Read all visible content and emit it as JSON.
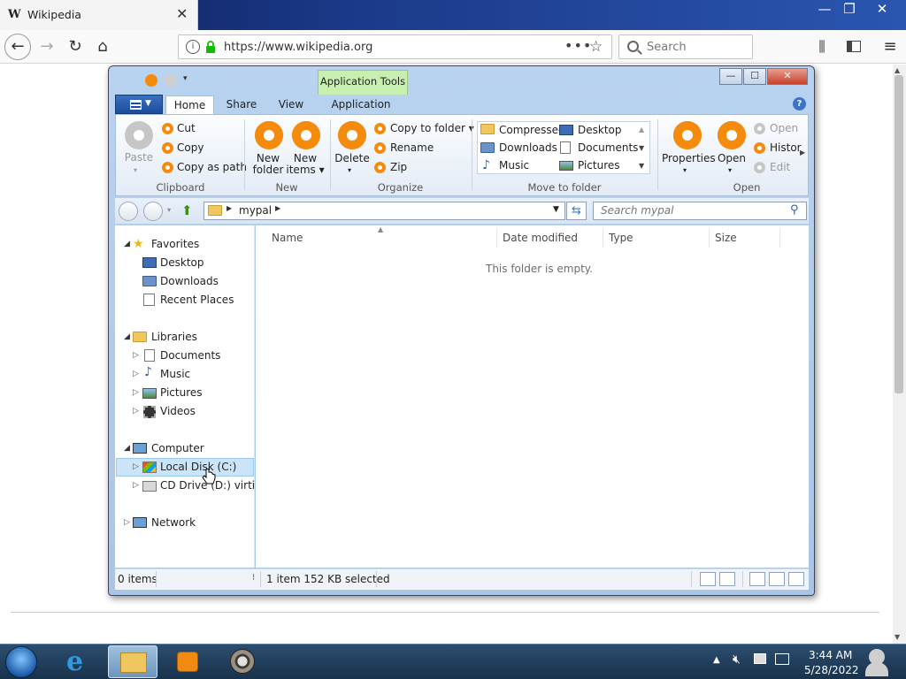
{
  "browser": {
    "tab_title": "Wikipedia",
    "tab_favicon": "W",
    "url": "https://www.wikipedia.org",
    "search_placeholder": "Search",
    "window_buttons": [
      "—",
      "❐",
      "✕"
    ]
  },
  "explorer": {
    "contextual_tab": "Application Tools",
    "caption_buttons": [
      "—",
      "☐",
      "✕"
    ],
    "ribbon_tabs": [
      "Home",
      "Share",
      "View",
      "Application"
    ],
    "clipboard": {
      "paste": "Paste",
      "cut": "Cut",
      "copy": "Copy",
      "copy_as_path": "Copy as path",
      "group": "Clipboard"
    },
    "new": {
      "new_folder_l1": "New",
      "new_folder_l2": "folder",
      "new_items_l1": "New",
      "new_items_l2": "items ▾",
      "group": "New"
    },
    "organize": {
      "delete": "Delete",
      "copy_to_folder": "Copy to folder ▾",
      "rename": "Rename",
      "zip": "Zip",
      "group": "Organize"
    },
    "move_to": {
      "items": [
        "Compressed",
        "Downloads",
        "Music",
        "Desktop",
        "Documents",
        "Pictures"
      ],
      "group": "Move to folder"
    },
    "open": {
      "properties": "Properties",
      "open": "Open",
      "open_small": "Open",
      "history": "Histor",
      "edit": "Edit",
      "group": "Open"
    },
    "address": {
      "crumb": "mypal",
      "search_placeholder": "Search mypal"
    },
    "nav": {
      "favorites": "Favorites",
      "desktop": "Desktop",
      "downloads": "Downloads",
      "recent_places": "Recent Places",
      "libraries": "Libraries",
      "documents": "Documents",
      "music": "Music",
      "pictures": "Pictures",
      "videos": "Videos",
      "computer": "Computer",
      "local_disk": "Local Disk (C:)",
      "cd_drive": "CD Drive (D:) virtio-w",
      "network": "Network"
    },
    "columns": [
      "Name",
      "Date modified",
      "Type",
      "Size"
    ],
    "empty_message": "This folder is empty.",
    "status": {
      "items": "0 items",
      "selection": "1 item 152 KB selected"
    }
  },
  "taskbar": {
    "time": "3:44 AM",
    "date": "5/28/2022"
  },
  "colors": {
    "accent_orange": "#f58b0d",
    "titlebar_blue": "#1b3a8a",
    "selection": "#cce4f7",
    "app_tools_green": "#c8efb0"
  }
}
